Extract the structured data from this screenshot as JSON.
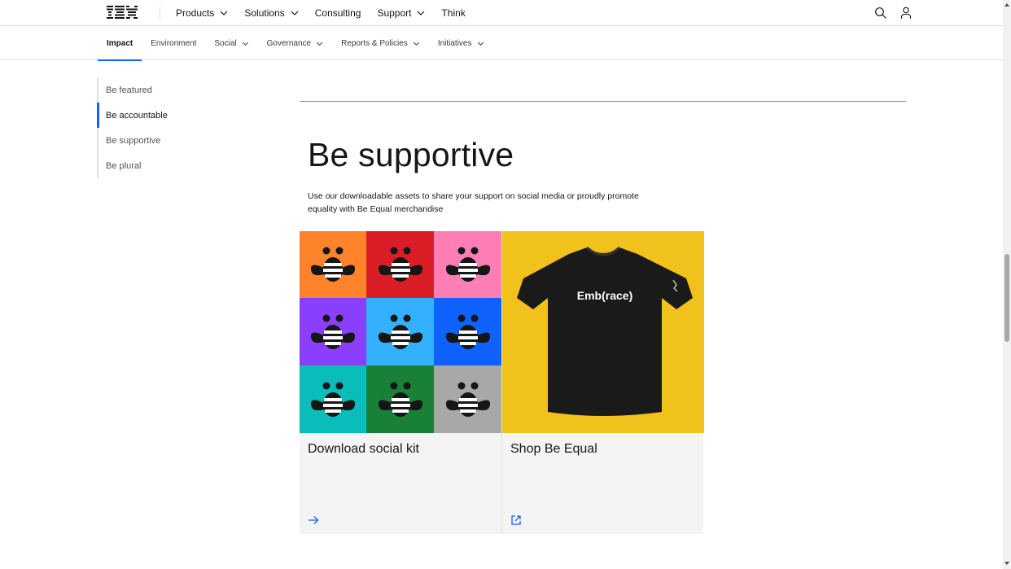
{
  "masthead": {
    "brand": "IBM",
    "nav": [
      {
        "label": "Products",
        "has_menu": true
      },
      {
        "label": "Solutions",
        "has_menu": true
      },
      {
        "label": "Consulting",
        "has_menu": false
      },
      {
        "label": "Support",
        "has_menu": true
      },
      {
        "label": "Think",
        "has_menu": false
      }
    ],
    "icons": [
      "search-icon",
      "user-icon"
    ]
  },
  "l1_nav": {
    "items": [
      {
        "label": "Impact",
        "active": true,
        "has_menu": false
      },
      {
        "label": "Environment",
        "active": false,
        "has_menu": false
      },
      {
        "label": "Social",
        "active": false,
        "has_menu": true
      },
      {
        "label": "Governance",
        "active": false,
        "has_menu": true
      },
      {
        "label": "Reports & Policies",
        "active": false,
        "has_menu": true
      },
      {
        "label": "Initiatives",
        "active": false,
        "has_menu": true
      }
    ]
  },
  "toc": {
    "items": [
      {
        "label": "Be featured",
        "active": false
      },
      {
        "label": "Be accountable",
        "active": true
      },
      {
        "label": "Be supportive",
        "active": false
      },
      {
        "label": "Be plural",
        "active": false
      }
    ]
  },
  "section": {
    "heading": "Be supportive",
    "lede": "Use our downloadable assets to share your support on social media or proudly promote equality with Be Equal merchandise"
  },
  "cards": [
    {
      "title": "Download social kit",
      "icon": "arrow-right-icon"
    },
    {
      "title": "Shop Be Equal",
      "icon": "launch-icon",
      "shirt_text": "Emb(race)"
    }
  ],
  "bee_tiles": [
    {
      "bg": "#ff832b",
      "stripe": "#ffffff"
    },
    {
      "bg": "#da1e28",
      "stripe": "#ffffff"
    },
    {
      "bg": "#ff7eb6",
      "stripe": "#ffffff"
    },
    {
      "bg": "#8a3ffc",
      "stripe": "#ffffff"
    },
    {
      "bg": "#33b1ff",
      "stripe": "#ffffff"
    },
    {
      "bg": "#0f62fe",
      "stripe": "#ffffff"
    },
    {
      "bg": "#08bdba",
      "stripe": "#ffffff"
    },
    {
      "bg": "#198038",
      "stripe": "#ffffff"
    },
    {
      "bg": "#a8a8a8",
      "stripe": "#ffffff"
    }
  ],
  "colors": {
    "accent": "#0f62fe",
    "card_bg": "#f4f4f4",
    "shirt_bg": "#f1c21b"
  }
}
